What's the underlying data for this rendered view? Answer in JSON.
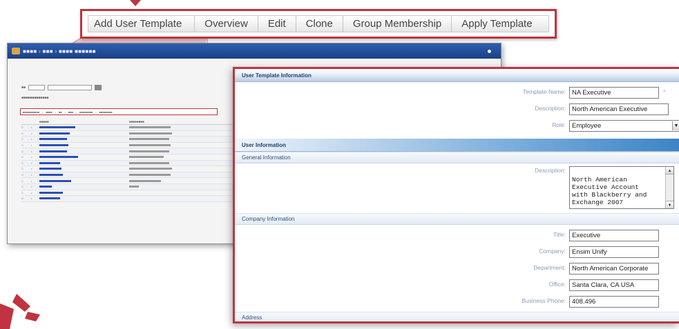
{
  "callout": {
    "tabs": [
      {
        "label": "Add User Template"
      },
      {
        "label": "Overview"
      },
      {
        "label": "Edit"
      },
      {
        "label": "Clone"
      },
      {
        "label": "Group Membership"
      },
      {
        "label": "Apply Template"
      }
    ]
  },
  "colors": {
    "accent_red": "#c0333f",
    "titlebar_blue": "#1c3f86",
    "section_blue": "#3c84c6",
    "link_blue": "#2b4fb5"
  },
  "detail": {
    "sections": {
      "template_info": "User Template Information",
      "user_info": "User Information",
      "general_info": "General Information",
      "company_info": "Company Information",
      "address": "Address"
    },
    "template_name": {
      "label": "Template Name:",
      "value": "NA Executive"
    },
    "description": {
      "label": "Description:",
      "value": "North American Executive"
    },
    "role": {
      "label": "Role:",
      "value": "Employee"
    },
    "general_description": {
      "label": "Description:",
      "value": "North American\nExecutive Account\nwith Blackberry and\nExchange 2007"
    },
    "title": {
      "label": "Title:",
      "value": "Executive"
    },
    "company": {
      "label": "Company:",
      "value": "Ensim Unify"
    },
    "department": {
      "label": "Department:",
      "value": "North American Corporate"
    },
    "office": {
      "label": "Office:",
      "value": "Santa Clara, CA USA"
    },
    "business_phone": {
      "label": "Business Phone:",
      "value": "408.496"
    }
  },
  "icons": {
    "dropdown": "chevron-down-icon",
    "scroll_up": "arrow-up-icon",
    "scroll_down": "arrow-down-icon",
    "brand": "brand-logo-icon"
  }
}
